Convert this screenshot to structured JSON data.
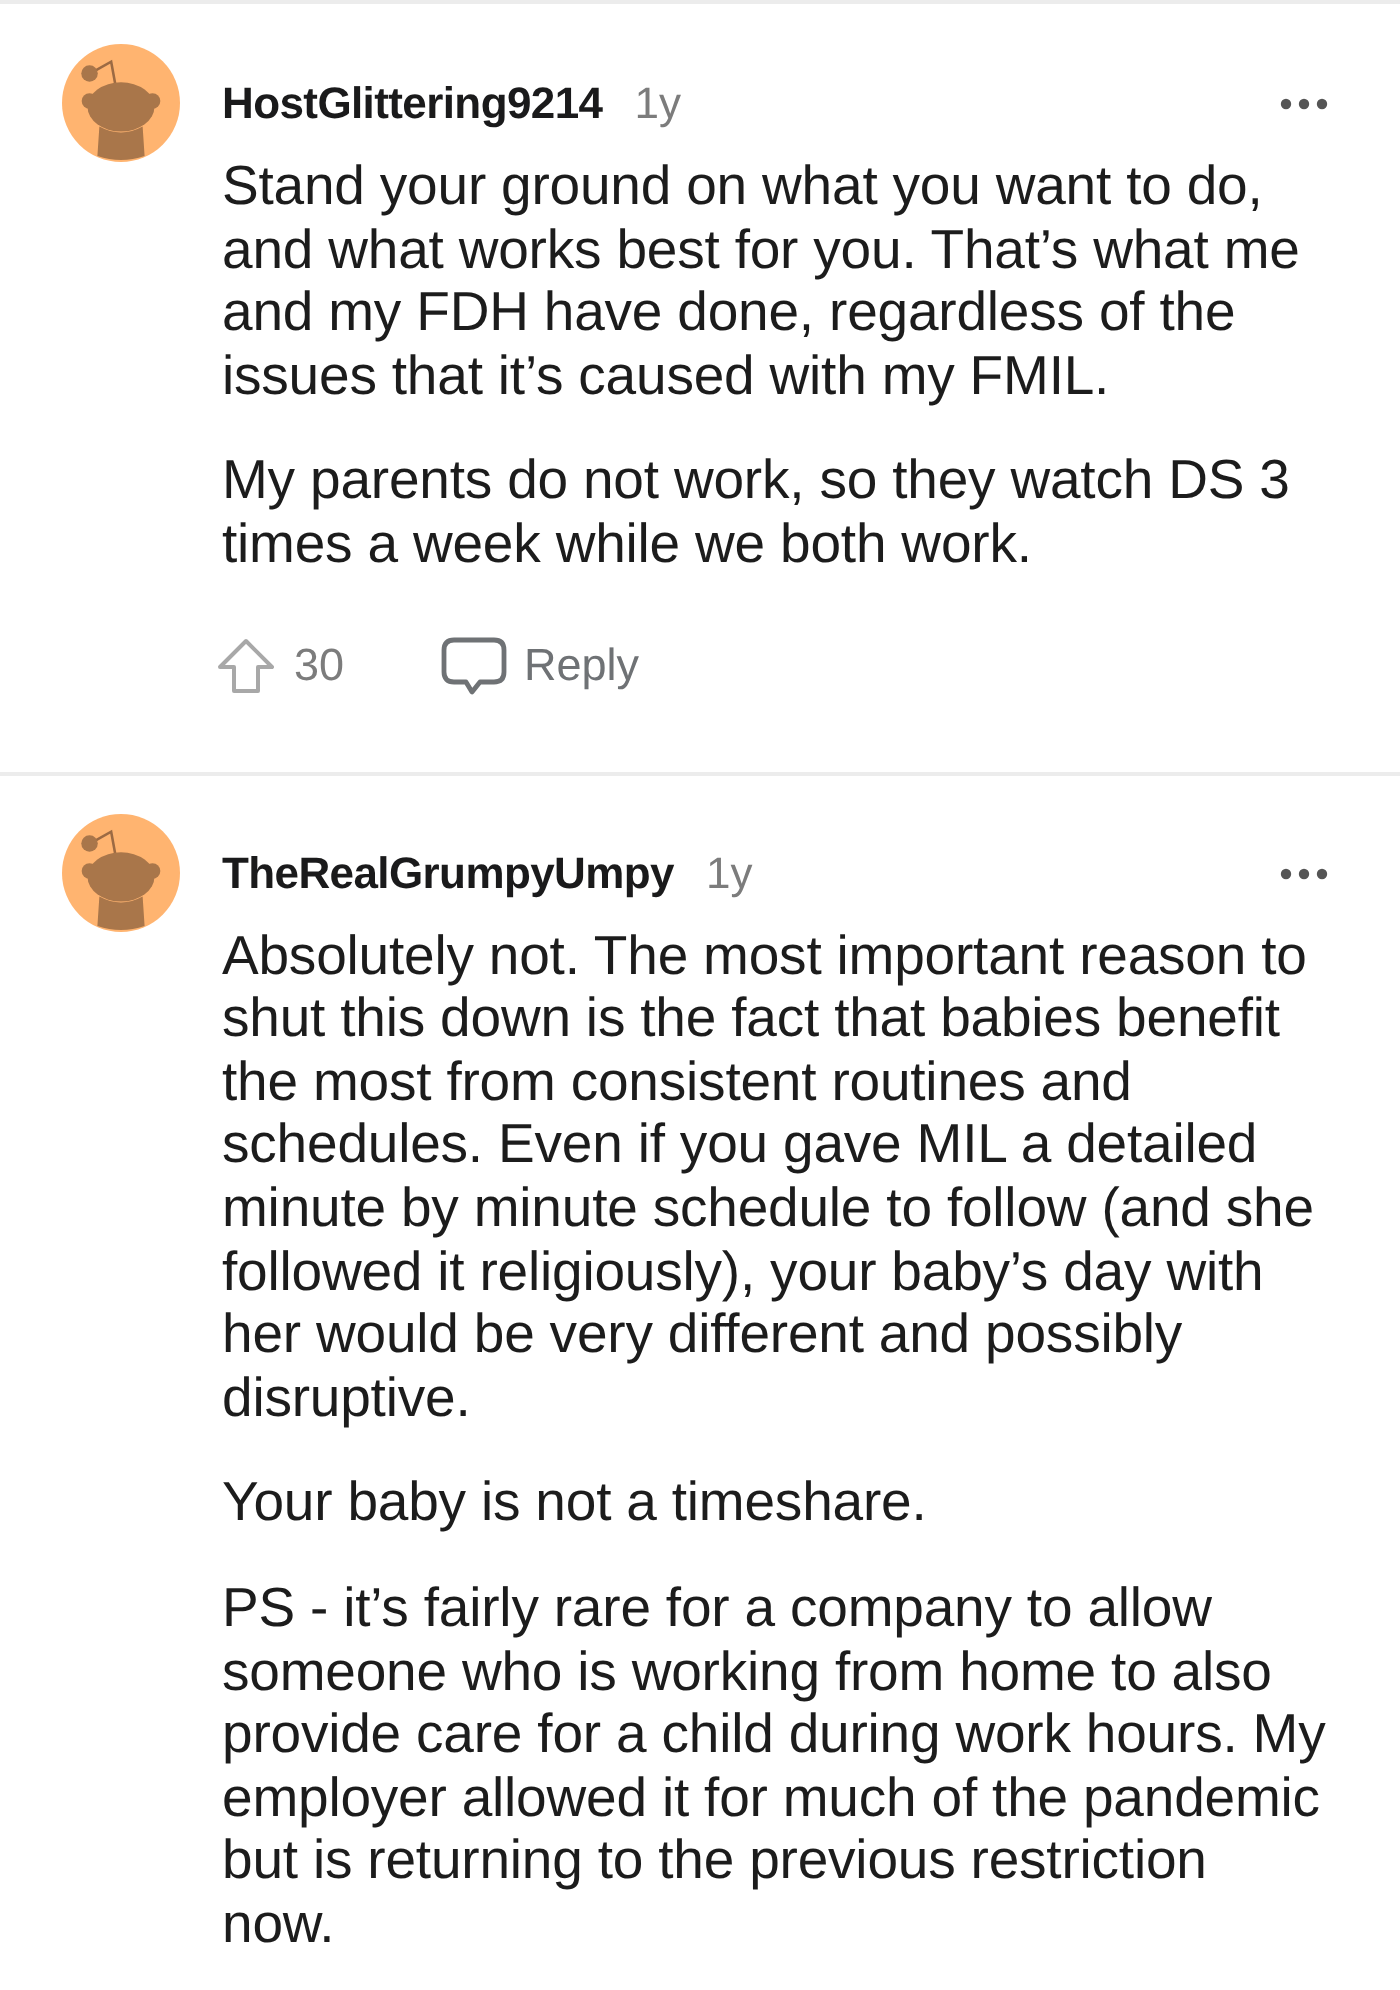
{
  "comments": [
    {
      "author": "HostGlittering9214",
      "age": "1y",
      "paragraphs": [
        "Stand your ground on what you want to do, and what works best for you. That’s what me and my FDH have done, regardless of the issues that it’s caused with my FMIL.",
        "My parents do not work, so they watch DS 3 times a week while we both work."
      ],
      "actions": {
        "upvotes": "30",
        "reply": "Reply"
      }
    },
    {
      "author": "TheRealGrumpyUmpy",
      "age": "1y",
      "paragraphs": [
        "Absolutely not. The most important reason to shut this down is the fact that babies benefit the most from consistent routines and schedules. Even if you gave MIL a detailed minute by minute schedule to follow (and she followed it religiously), your baby’s day with her would be very different and possibly disruptive.",
        "Your baby is not a timeshare.",
        "PS - it’s fairly rare for a company to allow someone who is working from home to also provide care for a child during work hours. My employer allowed it for much of the pandemic but is returning to the previous restriction now."
      ]
    }
  ]
}
